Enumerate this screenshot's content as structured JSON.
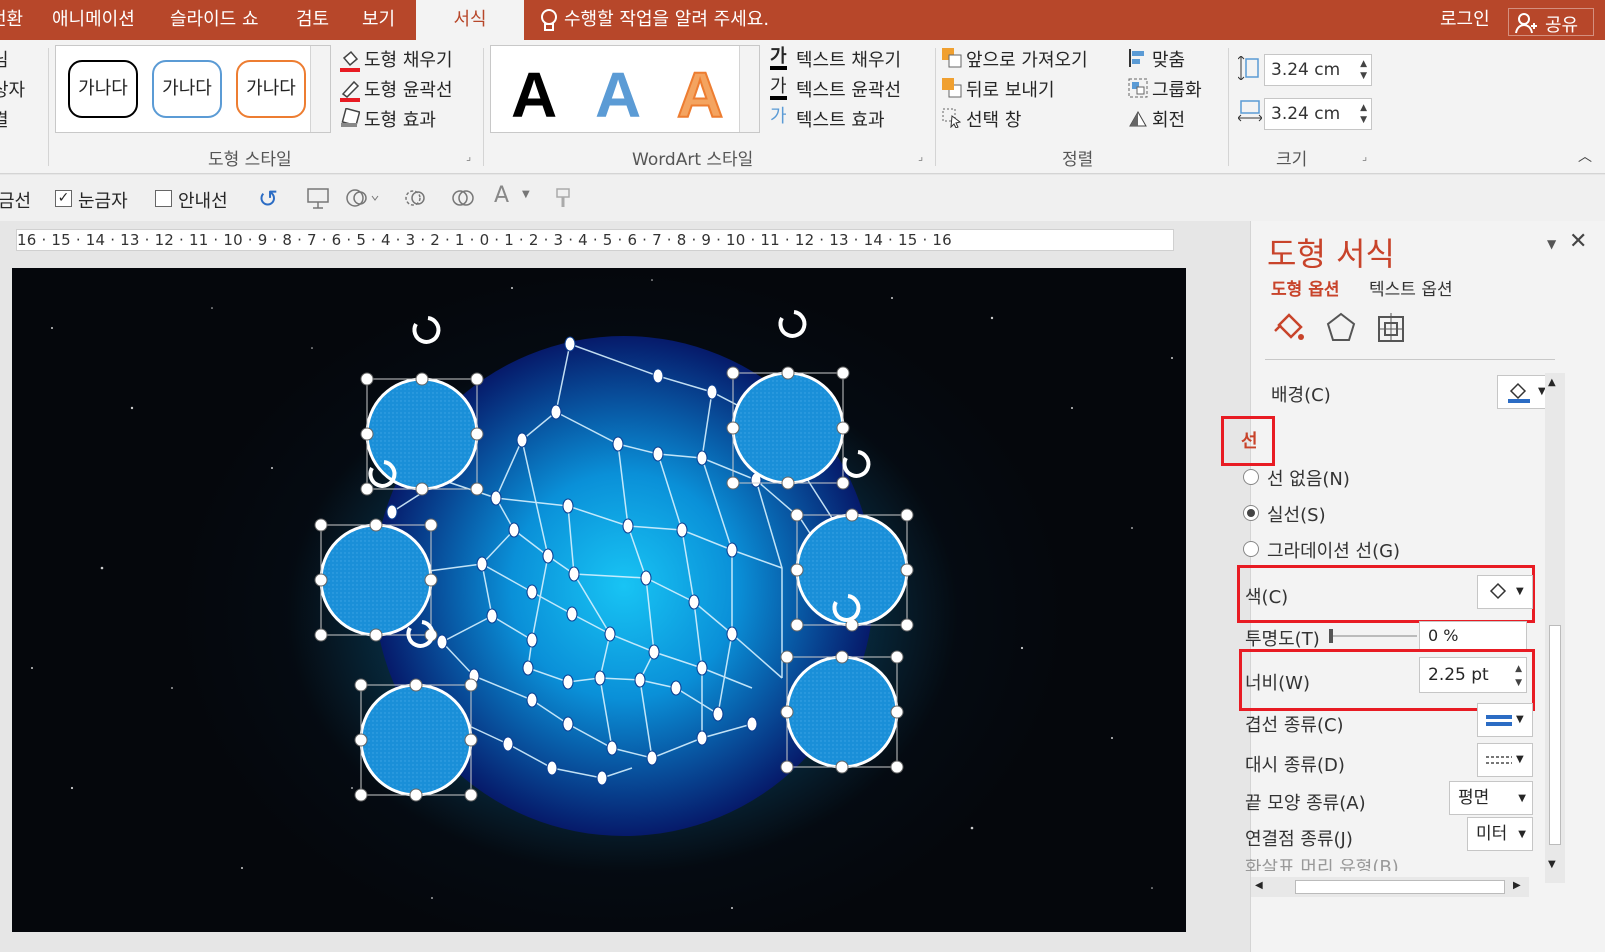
{
  "tabs": [
    {
      "label": "전환"
    },
    {
      "label": "애니메이션"
    },
    {
      "label": "슬라이드 쇼"
    },
    {
      "label": "검토"
    },
    {
      "label": "보기"
    },
    {
      "label": "서식",
      "active": true
    }
  ],
  "tell_me": "수행할 작업을 알려 주세요.",
  "account": {
    "login": "로그인",
    "share": "공유"
  },
  "left_cut": {
    "line1": "님",
    "line2": "상자",
    "line3": "결"
  },
  "shape_styles": {
    "samples": [
      "가나다",
      "가나다",
      "가나다"
    ],
    "sample_colors": [
      "#000000",
      "#5b9bd5",
      "#ed7d31"
    ],
    "fill": "도형 채우기",
    "outline": "도형 윤곽선",
    "effects": "도형 효과",
    "group_label": "도형 스타일"
  },
  "wordart": {
    "letters": [
      "A",
      "A",
      "A"
    ],
    "text_fill": "텍스트 채우기",
    "text_outline": "텍스트 윤곽선",
    "text_effects": "텍스트 효과",
    "group_label": "WordArt 스타일"
  },
  "arrange": {
    "bring_forward": "앞으로 가져오기",
    "send_backward": "뒤로 보내기",
    "selection_pane": "선택 창",
    "align": "맞춤",
    "group": "그룹화",
    "rotate": "회전",
    "group_label": "정렬"
  },
  "size": {
    "height": "3.24 cm",
    "width": "3.24 cm",
    "group_label": "크기"
  },
  "view_row": {
    "gridlines_partial": "금선",
    "ruler": "눈금자",
    "guides": "안내선",
    "ruler_checked": true,
    "guides_checked": false
  },
  "ruler_text": "16 · 15 · 14 · 13 · 12 · 11 · 10 · 9 · 8 · 7 · 6 · 5 · 4 · 3 · 2 · 1 · 0 · 1 · 2 · 3 · 4 · 5 · 6 · 7 · 8 · 9 · 10 · 11 · 12 · 13 · 14 · 15 · 16",
  "panel": {
    "title": "도형 서식",
    "tab_shape": "도형 옵션",
    "tab_text": "텍스트 옵션",
    "background": "배경(C)",
    "line_section": "선",
    "no_line": "선 없음(N)",
    "solid_line": "실선(S)",
    "gradient_line": "그라데이션 선(G)",
    "color": "색(C)",
    "transparency": "투명도(T)",
    "transparency_value": "0 %",
    "width": "너비(W)",
    "width_value": "2.25 pt",
    "compound": "겹선 종류(C)",
    "dash": "대시 종류(D)",
    "cap": "끝 모양 종류(A)",
    "cap_value": "평면",
    "join": "연결점 종류(J)",
    "join_value": "미터",
    "arrow_partial": "화살표 머리 유형(B)"
  },
  "colors": {
    "accent": "#b7472a",
    "highlight": "#e81b23",
    "shape_fill": "#1a8fd8"
  }
}
